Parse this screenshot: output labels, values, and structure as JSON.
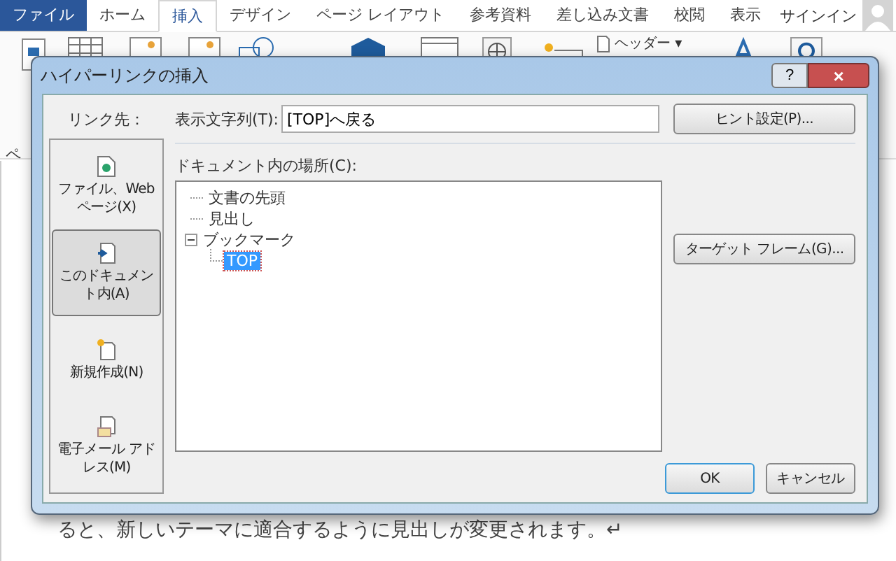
{
  "ribbon": {
    "tabs": [
      {
        "label": "ファイル",
        "kind": "file",
        "selected": false
      },
      {
        "label": "ホーム",
        "kind": "tab",
        "selected": false
      },
      {
        "label": "挿入",
        "kind": "tab",
        "selected": true
      },
      {
        "label": "デザイン",
        "kind": "tab",
        "selected": false
      },
      {
        "label": "ページ レイアウト",
        "kind": "tab",
        "selected": false
      },
      {
        "label": "参考資料",
        "kind": "tab",
        "selected": false
      },
      {
        "label": "差し込み文書",
        "kind": "tab",
        "selected": false
      },
      {
        "label": "校閲",
        "kind": "tab",
        "selected": false
      },
      {
        "label": "表示",
        "kind": "tab",
        "selected": false
      }
    ],
    "sign_in": "サインイン",
    "header_button": "ヘッダー",
    "header_caret": "▾",
    "page_label": "ペ"
  },
  "dialog": {
    "title": "ハイパーリンクの挿入",
    "help": "?",
    "close": "×",
    "link_to_label": "リンク先：",
    "link_to": [
      {
        "label": "ファイル、Web ページ(X)",
        "kind": "file",
        "selected": false
      },
      {
        "label": "このドキュメント内(A)",
        "kind": "document",
        "selected": true
      },
      {
        "label": "新規作成(N)",
        "kind": "new",
        "selected": false
      },
      {
        "label": "電子メール アドレス(M)",
        "kind": "mail",
        "selected": false
      }
    ],
    "display_text_label": "表示文字列(T):",
    "display_text": "[TOP]へ戻る",
    "hint_button": "ヒント設定(P)...",
    "place_label": "ドキュメント内の場所(C):",
    "tree": [
      {
        "label": "文書の先頭",
        "selected": false
      },
      {
        "label": "見出し",
        "selected": false
      },
      {
        "label": "ブックマーク",
        "selected": false,
        "expanded": true,
        "children": [
          {
            "label": "TOP",
            "selected": true
          }
        ]
      }
    ],
    "target_frame_button": "ターゲット フレーム(G)...",
    "ok": "OK",
    "cancel": "キャンセル"
  },
  "document_text": "ると、新しいテーマに適合するように見出しが変更されます。↵"
}
